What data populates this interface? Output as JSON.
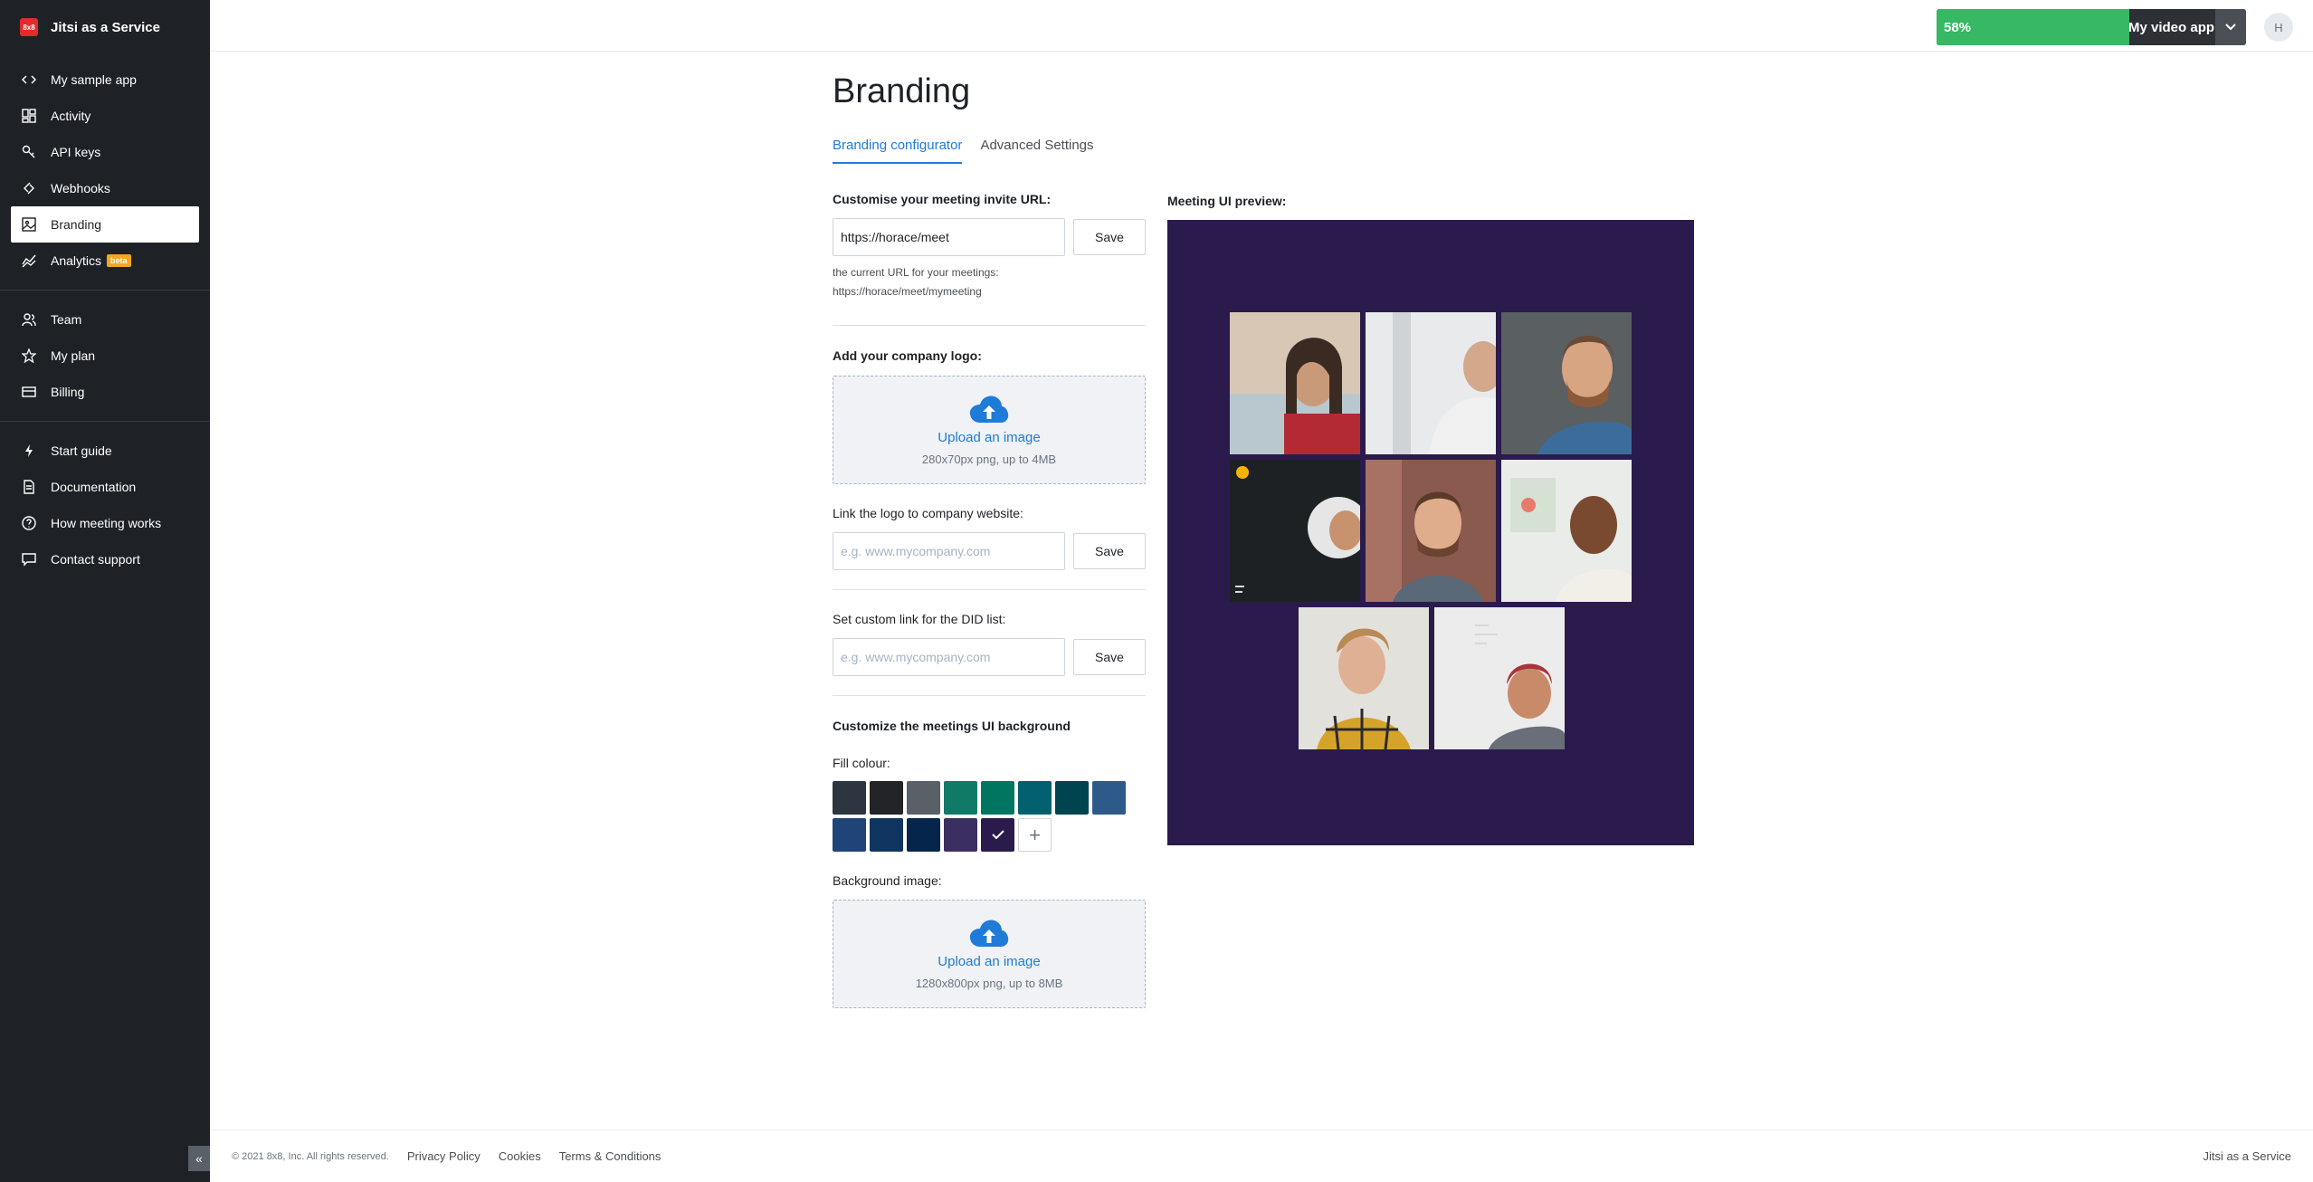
{
  "sidebar": {
    "brand": "Jitsi as a Service",
    "brand_logo_text": "8x8",
    "items_a": [
      {
        "label": "My sample app",
        "icon": "code-icon"
      },
      {
        "label": "Activity",
        "icon": "dashboard-icon"
      },
      {
        "label": "API keys",
        "icon": "key-icon"
      },
      {
        "label": "Webhooks",
        "icon": "webhook-icon"
      },
      {
        "label": "Branding",
        "icon": "image-icon",
        "active": true
      },
      {
        "label": "Analytics",
        "icon": "chart-icon",
        "badge": "beta"
      }
    ],
    "items_b": [
      {
        "label": "Team",
        "icon": "team-icon"
      },
      {
        "label": "My plan",
        "icon": "star-icon"
      },
      {
        "label": "Billing",
        "icon": "card-icon"
      }
    ],
    "items_c": [
      {
        "label": "Start guide",
        "icon": "lightning-icon"
      },
      {
        "label": "Documentation",
        "icon": "document-icon"
      },
      {
        "label": "How meeting works",
        "icon": "help-icon"
      },
      {
        "label": "Contact support",
        "icon": "chat-icon"
      }
    ]
  },
  "topbar": {
    "progress": "58%",
    "progress_value": 0.58,
    "app_name": "My video app",
    "avatar": "H"
  },
  "page": {
    "title": "Branding",
    "tabs": [
      "Branding configurator",
      "Advanced Settings"
    ]
  },
  "form": {
    "invite_label": "Customise your meeting invite URL:",
    "invite_value": "https://horace/meet",
    "save": "Save",
    "current_url_hint": "the current URL for your meetings:",
    "current_url": "https://horace/meet/mymeeting",
    "logo_label": "Add your company logo:",
    "upload_text": "Upload an image",
    "logo_note": "280x70px png, up to 4MB",
    "website_label": "Link the logo to company website:",
    "placeholder": "e.g. www.mycompany.com",
    "did_label": "Set custom link for the DID list:",
    "bg_heading": "Customize the meetings UI background",
    "fill_label": "Fill colour:",
    "bg_image_label": "Background image:",
    "bg_note": "1280x800px png, up to 8MB",
    "colors": [
      "#2d3540",
      "#222427",
      "#5a6068",
      "#117a66",
      "#007560",
      "#00606e",
      "#004450",
      "#2e5a8a",
      "#1e4478",
      "#0f3560",
      "#06254a",
      "#3b2e60",
      "#2a1b4c"
    ],
    "selected_color": "#2a1b4c"
  },
  "preview": {
    "label": "Meeting UI preview:"
  },
  "footer": {
    "copyright": "© 2021 8x8, Inc. All rights reserved.",
    "links": [
      "Privacy Policy",
      "Cookies",
      "Terms & Conditions"
    ],
    "right": "Jitsi as a Service"
  }
}
